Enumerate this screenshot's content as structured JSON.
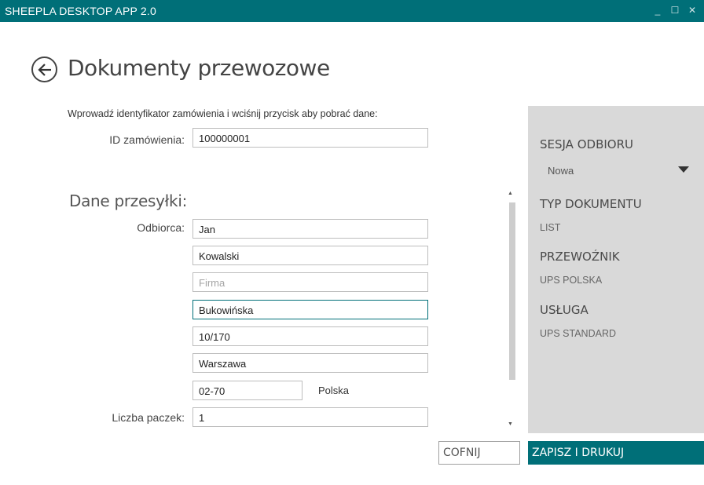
{
  "window": {
    "title": "SHEEPLA DESKTOP APP 2.0",
    "minimize_glyph": "_",
    "maximize_glyph": "☐",
    "close_glyph": "✕"
  },
  "header": {
    "back_icon": "back-arrow-circle-icon",
    "title": "Dokumenty przewozowe"
  },
  "order": {
    "instruction": "Wprowadź identyfikator zamówienia i wciśnij przycisk aby pobrać dane:",
    "id_label": "ID zamówienia:",
    "id_value": "100000001"
  },
  "shipment": {
    "section_title": "Dane przesyłki:",
    "recipient_label": "Odbiorca:",
    "first_name": "Jan",
    "last_name": "Kowalski",
    "company_placeholder": "Firma",
    "street": "Bukowińska",
    "house_number": "10/170",
    "city": "Warszawa",
    "postal_code": "02-70",
    "country": "Polska",
    "packages_label": "Liczba paczek:",
    "packages_value": "1"
  },
  "scrollbar": {
    "up_glyph": "▲",
    "down_glyph": "▼"
  },
  "side_panel": {
    "session_heading": "SESJA ODBIORU",
    "session_value": "Nowa",
    "doc_type_heading": "TYP DOKUMENTU",
    "doc_type_value": "LIST",
    "carrier_heading": "PRZEWOŹNIK",
    "carrier_value": "UPS POLSKA",
    "service_heading": "USŁUGA",
    "service_value": "UPS STANDARD"
  },
  "actions": {
    "back_label": "COFNIJ",
    "save_print_label": "ZAPISZ I DRUKUJ"
  },
  "colors": {
    "accent": "#006f78",
    "panel": "#d9d9d9"
  }
}
